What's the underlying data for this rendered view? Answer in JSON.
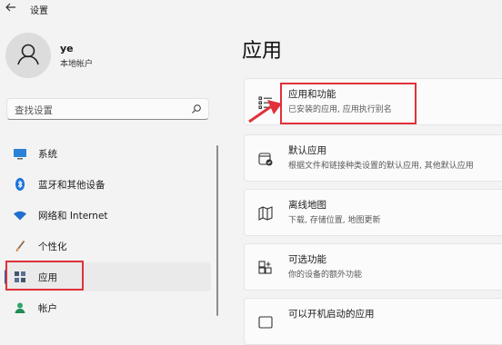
{
  "window": {
    "title": "设置"
  },
  "profile": {
    "name": "ye",
    "account_type": "本地帐户"
  },
  "search": {
    "placeholder": "查找设置"
  },
  "sidebar": {
    "items": [
      {
        "label": "系统",
        "icon": "system-monitor-icon"
      },
      {
        "label": "蓝牙和其他设备",
        "icon": "bluetooth-icon"
      },
      {
        "label": "网络和 Internet",
        "icon": "wifi-icon"
      },
      {
        "label": "个性化",
        "icon": "brush-icon"
      },
      {
        "label": "应用",
        "icon": "apps-icon",
        "selected": true
      },
      {
        "label": "帐户",
        "icon": "account-icon"
      }
    ]
  },
  "main": {
    "title": "应用",
    "cards": [
      {
        "title": "应用和功能",
        "subtitle": "已安装的应用, 应用执行别名",
        "icon": "list-icon"
      },
      {
        "title": "默认应用",
        "subtitle": "根据文件和链接种类设置的默认应用, 其他默认应用",
        "icon": "default-apps-icon"
      },
      {
        "title": "离线地图",
        "subtitle": "下载, 存储位置, 地图更新",
        "icon": "map-icon"
      },
      {
        "title": "可选功能",
        "subtitle": "你的设备的额外功能",
        "icon": "optional-features-icon"
      },
      {
        "title": "可以开机启动的应用",
        "subtitle": "",
        "icon": "startup-icon"
      }
    ]
  },
  "colors": {
    "accent": "#0067c0",
    "annotation": "#e0313a",
    "background": "#f3f3f3",
    "card": "#fbfbfb"
  }
}
